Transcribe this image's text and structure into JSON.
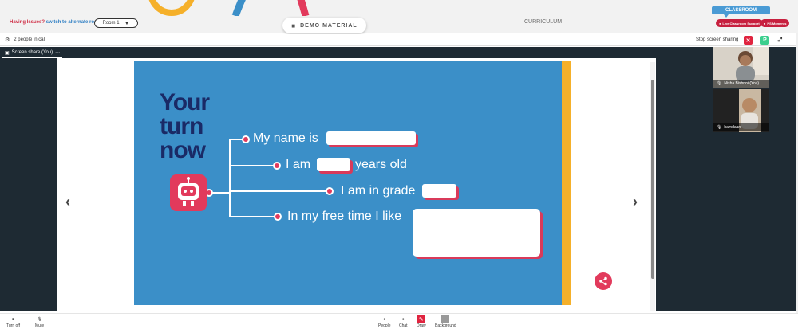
{
  "header": {
    "issues_text": "Having Issues?",
    "alt_room_link": "switch to alternate room",
    "room_select_value": "Room 1",
    "demo_material_label": "DEMO MATERIAL",
    "curriculum_label": "CURRICULUM",
    "classroom_tab_label": "CLASSROOM",
    "live_support_label": "Live Classroom Support",
    "ps_moments_label": "PS Moments"
  },
  "callbar": {
    "people_count_text": "2 people in call",
    "stop_sharing_label": "Stop screen sharing",
    "close_share_icon": "close-icon",
    "p_badge": "P"
  },
  "share": {
    "tab_label": "Screen share (You)",
    "tab_menu": "···"
  },
  "slide": {
    "heading_line1": "Your",
    "heading_line2": "turn",
    "heading_line3": "now",
    "prompt1": "My name is",
    "prompt2a": "I am",
    "prompt2b": "years old",
    "prompt3": "I am in grade",
    "prompt4": "In my free time I like"
  },
  "participants": [
    {
      "name": "Nisha Bishnoi (You)"
    },
    {
      "name": "hamdaan"
    }
  ],
  "bottombar": {
    "turn_off": "Turn off",
    "mute": "Mute",
    "people": "People",
    "chat": "Chat",
    "draw": "Draw",
    "background": "Background"
  },
  "colors": {
    "accent_blue": "#3b8fc8",
    "accent_red": "#e23a5c",
    "slide_edge": "#f5b02a",
    "heading_navy": "#1a2a66"
  }
}
